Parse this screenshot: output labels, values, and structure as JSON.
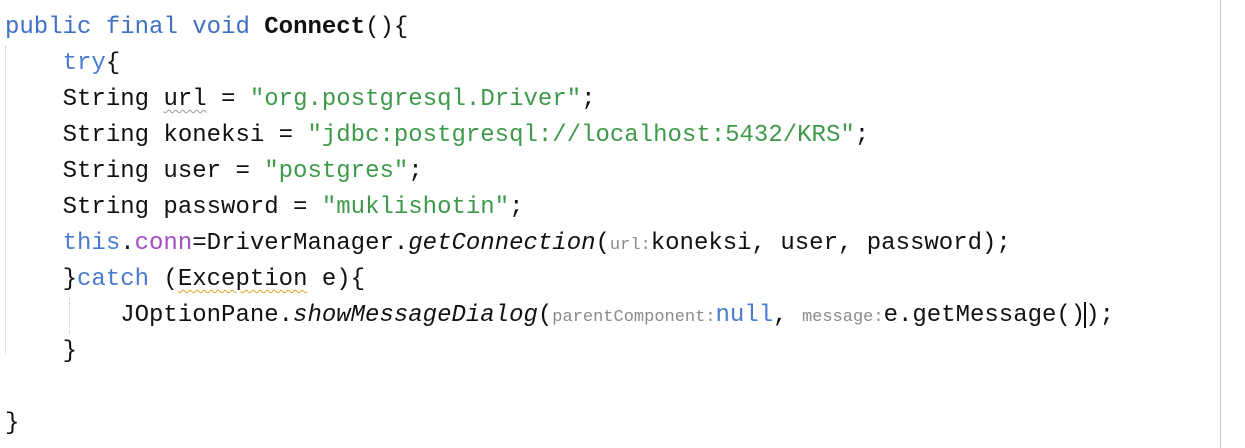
{
  "editor": {
    "language": "java",
    "caret_line": 9,
    "lines": [
      [
        "public",
        "final",
        "void",
        "Connect",
        "(){"
      ],
      [
        "try",
        "{"
      ],
      [
        "String url = ",
        "\"org.postgresql.Driver\"",
        ";"
      ],
      [
        "String koneksi = ",
        "\"jdbc:postgresql://localhost:5432/KRS\"",
        ";"
      ],
      [
        "String user = ",
        "\"postgres\"",
        ";"
      ],
      [
        "String password = ",
        "\"muklishotin\"",
        ";"
      ],
      [
        "this",
        ".",
        "conn",
        "=DriverManager.",
        "getConnection",
        "(",
        "url:",
        "koneksi, user, password);"
      ],
      [
        "}",
        "catch",
        " (",
        "Exception",
        " e){"
      ],
      [
        "JOptionPane.",
        "showMessageDialog",
        "(",
        "parentComponent:",
        "null",
        ", ",
        "message:",
        "e.getMessage()",
        ")",
        ";"
      ],
      [
        "}"
      ],
      [
        ""
      ],
      [
        "}"
      ]
    ]
  },
  "theme": {
    "keyword": "#3f6fc6",
    "string": "#3e9a4a",
    "field": "#a34fc4",
    "hint": "#8a8a8a",
    "warning_underline": "#e8a020",
    "right_margin_line": "#e8b9c8"
  }
}
